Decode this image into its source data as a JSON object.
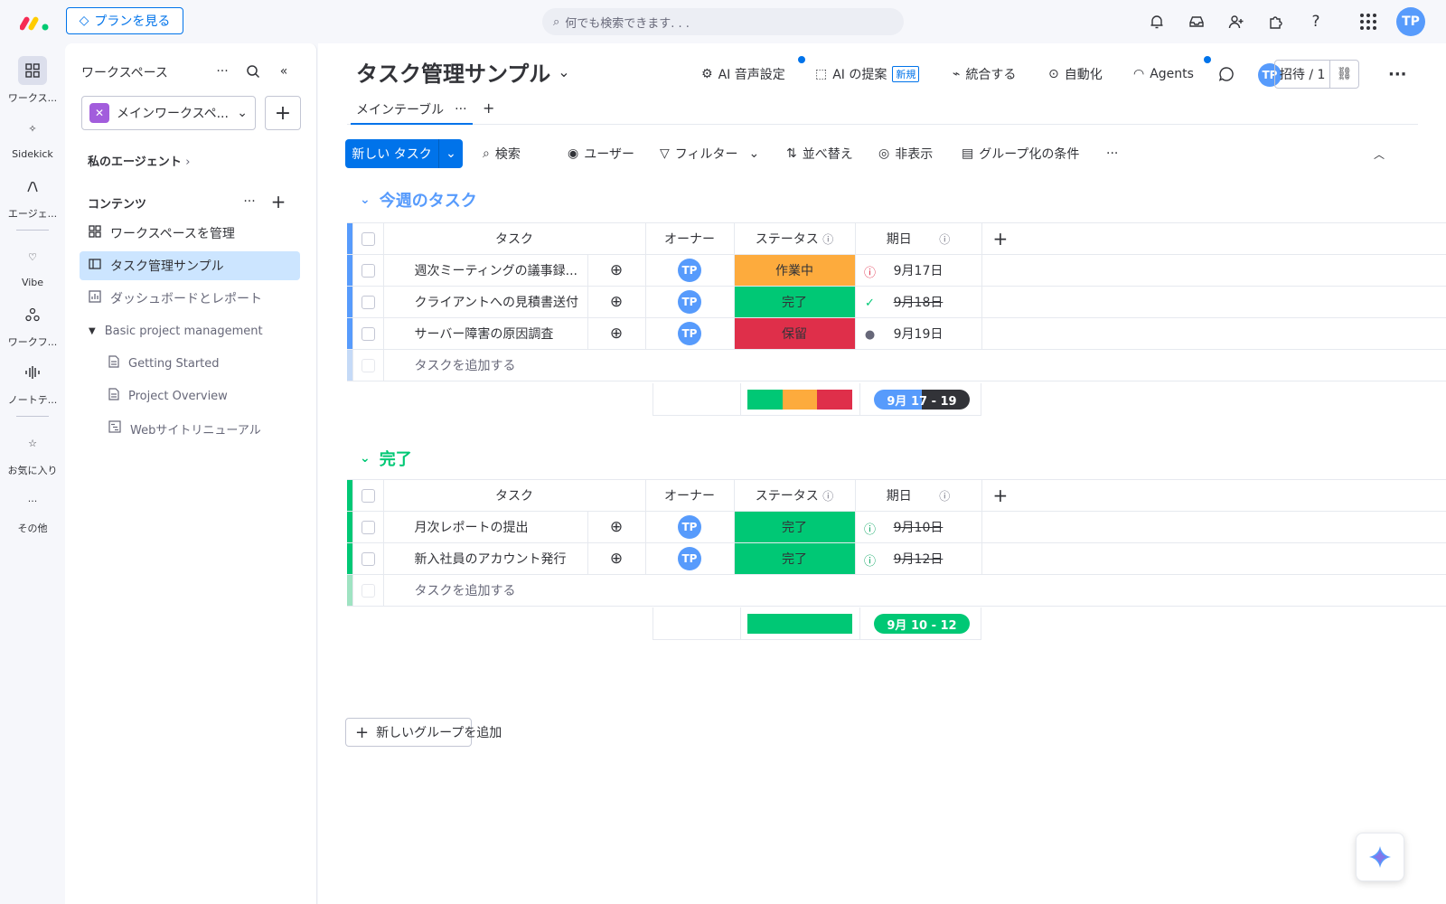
{
  "topbar": {
    "plans_label": "プランを見る",
    "search_placeholder": "何でも検索できます. . .",
    "avatar_initials": "TP"
  },
  "rail": {
    "items": [
      {
        "label": "ワークス..."
      },
      {
        "label": "Sidekick"
      },
      {
        "label": "エージェ..."
      },
      {
        "label": "Vibe"
      },
      {
        "label": "ワークフ..."
      },
      {
        "label": "ノートテ..."
      },
      {
        "label": "お気に入り"
      },
      {
        "label": "その他"
      }
    ]
  },
  "sidebar": {
    "title": "ワークスペース",
    "workspace_name": "メインワークスペ...",
    "agents_link": "私のエージェント",
    "content_label": "コンテンツ",
    "items": [
      {
        "label": "ワークスペースを管理"
      },
      {
        "label": "タスク管理サンプル"
      },
      {
        "label": "ダッシュボードとレポート"
      },
      {
        "label": "Basic project management"
      },
      {
        "label": "Getting Started"
      },
      {
        "label": "Project Overview"
      },
      {
        "label": "Webサイトリニューアル"
      }
    ]
  },
  "board": {
    "title": "タスク管理サンプル",
    "actions": {
      "voice": "AI 音声設定",
      "suggest": "AI の提案",
      "new_tag": "新規",
      "integrate": "統合する",
      "automate": "自動化",
      "agents": "Agents"
    },
    "invite_label": "招待 / 1",
    "tab_label": "メインテーブル"
  },
  "toolbar": {
    "new_task": "新しい タスク",
    "search": "検索",
    "user": "ユーザー",
    "filter": "フィルター",
    "sort": "並べ替え",
    "hide": "非表示",
    "group_by": "グループ化の条件"
  },
  "columns": {
    "task": "タスク",
    "owner": "オーナー",
    "status": "ステータス",
    "date": "期日"
  },
  "groups": [
    {
      "title": "今週のタスク",
      "color": "#579bfc",
      "rows": [
        {
          "task": "週次ミーティングの議事録...",
          "owner": "TP",
          "status": "作業中",
          "status_color": "#fdab3d",
          "date": "9月17日",
          "date_icon": "alert-icon",
          "done": false
        },
        {
          "task": "クライアントへの見積書送付",
          "owner": "TP",
          "status": "完了",
          "status_color": "#00c875",
          "date": "9月18日",
          "date_icon": "check-icon",
          "done": true
        },
        {
          "task": "サーバー障害の原因調査",
          "owner": "TP",
          "status": "保留",
          "status_color": "#df2f4a",
          "date": "9月19日",
          "date_icon": "clock-icon",
          "done": false
        }
      ],
      "add_label": "タスクを追加する",
      "summary_date": "9月 17 - 19",
      "summary_status": [
        {
          "color": "#00c875",
          "share": 0.333
        },
        {
          "color": "#fdab3d",
          "share": 0.333
        },
        {
          "color": "#df2f4a",
          "share": 0.334
        }
      ]
    },
    {
      "title": "完了",
      "color": "#00c875",
      "rows": [
        {
          "task": "月次レポートの提出",
          "owner": "TP",
          "status": "完了",
          "status_color": "#00c875",
          "date": "9月10日",
          "date_icon": "alert-icon-green",
          "done": true
        },
        {
          "task": "新入社員のアカウント発行",
          "owner": "TP",
          "status": "完了",
          "status_color": "#00c875",
          "date": "9月12日",
          "date_icon": "alert-icon-green",
          "done": true
        }
      ],
      "add_label": "タスクを追加する",
      "summary_date": "9月 10 - 12",
      "summary_status": [
        {
          "color": "#00c875",
          "share": 1.0
        }
      ]
    }
  ],
  "add_group_label": "新しいグループを追加"
}
